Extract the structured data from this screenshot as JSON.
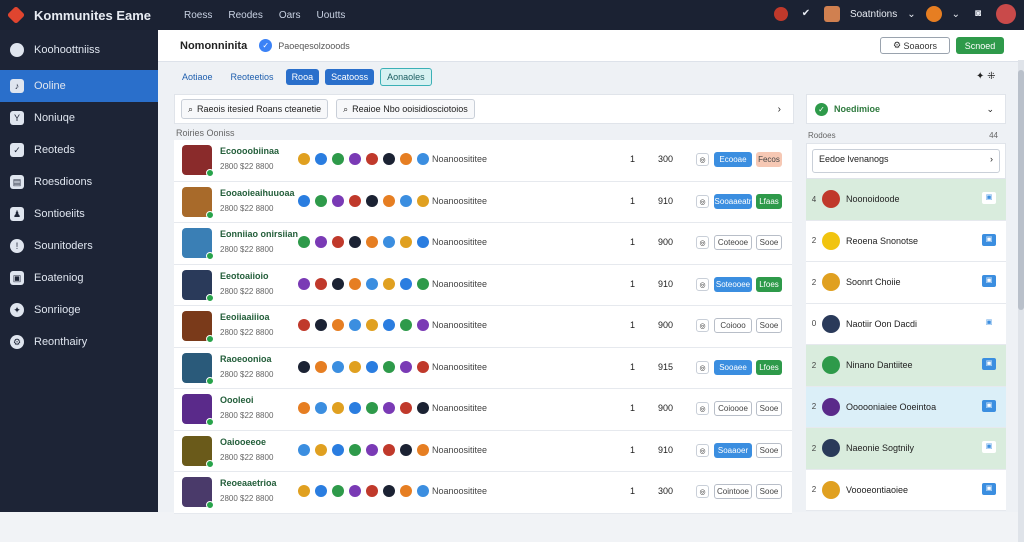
{
  "app": {
    "title": "Kommunites Eame",
    "nav": [
      "Roess",
      "Reodes",
      "Oars",
      "Uoutts"
    ],
    "user_label": "Soatntions"
  },
  "sidebar": {
    "header": "Koohoottniiss",
    "items": [
      "Ooline",
      "Noniuqe",
      "Reoteds",
      "Roesdioons",
      "Sontioeiits",
      "Sounitoders",
      "Eoateniog",
      "Sonriioge",
      "Reonthairy"
    ]
  },
  "header": {
    "title": "Nomonninita",
    "subtitle": "Paoeqesolzooods",
    "btn1": "Soaoors",
    "btn2": "Scnoed"
  },
  "tabs": [
    "Aotiaoe",
    "Reoteetios",
    "Rooa",
    "Scatooss",
    "Aonaoles"
  ],
  "filters": {
    "f1": "Raeois itesied Roans cteanetie",
    "f2": "Reaioe Nbo ooisidiosciotoios"
  },
  "list_header": "Roiries  Ooniss",
  "rows": [
    {
      "name": "Ecoooobiinaa",
      "sub": "2800  $22 8800",
      "handle": "Noanoosititee",
      "n1": "1",
      "n2": "300",
      "b1": "Ecooae",
      "b2": "Fecos",
      "bcol": "#3b8ee0",
      "b2col": "#f6c8b4"
    },
    {
      "name": "Eooaoieaihuuoaa",
      "sub": "2800  $22 8800",
      "handle": "Noanoosititee",
      "n1": "1",
      "n2": "910",
      "b1": "Sooaaeatr",
      "b2": "Lfaas",
      "bcol": "#3b8ee0",
      "b2col": "#2e9a4a"
    },
    {
      "name": "Eonniiao onirsiian",
      "sub": "2800  $22 8800",
      "handle": "Noanoosititee",
      "n1": "1",
      "n2": "900",
      "b1": "Coteooe",
      "b2": "Sooe",
      "bcol": "#ffffff",
      "b2col": "#ffffff"
    },
    {
      "name": "Eeotoaiioio",
      "sub": "2800  $22 8800",
      "handle": "Noanoosititee",
      "n1": "1",
      "n2": "910",
      "b1": "Soteooee",
      "b2": "Lfoes",
      "bcol": "#3b8ee0",
      "b2col": "#2e9a4a"
    },
    {
      "name": "Eeoiiaaiiioa",
      "sub": "2800  $22 8800",
      "handle": "Noanoosititee",
      "n1": "1",
      "n2": "900",
      "b1": "Coiooo",
      "b2": "Sooe",
      "bcol": "#ffffff",
      "b2col": "#ffffff"
    },
    {
      "name": "Raoeoonioa",
      "sub": "2800  $22 8800",
      "handle": "Noanoosititee",
      "n1": "1",
      "n2": "915",
      "b1": "Sooaee",
      "b2": "Lfoes",
      "bcol": "#3b8ee0",
      "b2col": "#2e9a4a"
    },
    {
      "name": "Oooleoi",
      "sub": "2800  $22 8800",
      "handle": "Noanoosititee",
      "n1": "1",
      "n2": "900",
      "b1": "Coioooe",
      "b2": "Sooe",
      "bcol": "#ffffff",
      "b2col": "#ffffff"
    },
    {
      "name": "Oaiooeeoe",
      "sub": "2800  $22 8800",
      "handle": "Noanoosititee",
      "n1": "1",
      "n2": "910",
      "b1": "Soaaoer",
      "b2": "Sooe",
      "bcol": "#3b8ee0",
      "b2col": "#ffffff"
    },
    {
      "name": "Reoeaaetrioa",
      "sub": "2800  $22 8800",
      "handle": "Noanoosititee",
      "n1": "1",
      "n2": "300",
      "b1": "Cointooe",
      "b2": "Sooe",
      "bcol": "#ffffff",
      "b2col": "#ffffff"
    }
  ],
  "right": {
    "title": "Noedimioe",
    "sub_left": "Rodoes",
    "sub_right": "44",
    "search": "Eedoe lvenanogs",
    "items": [
      {
        "rank": "4",
        "name": "Noonoidoode",
        "bg": "#d9ecdd"
      },
      {
        "rank": "2",
        "name": "Reoena Snonotse",
        "bg": "#ffffff"
      },
      {
        "rank": "2",
        "name": "Soonrt Choiie",
        "bg": "#ffffff"
      },
      {
        "rank": "0",
        "name": "Naotiir Oon Dacdi",
        "bg": "#ffffff"
      },
      {
        "rank": "2",
        "name": "Ninano Dantiitee",
        "bg": "#d9ecdd"
      },
      {
        "rank": "2",
        "name": "Oooooniaiee Ooeintoa",
        "bg": "#dbeff8"
      },
      {
        "rank": "2",
        "name": "Naeonie Sogtnily",
        "bg": "#d9ecdd"
      },
      {
        "rank": "2",
        "name": "Voooeontiaoiee",
        "bg": "#ffffff"
      }
    ]
  }
}
